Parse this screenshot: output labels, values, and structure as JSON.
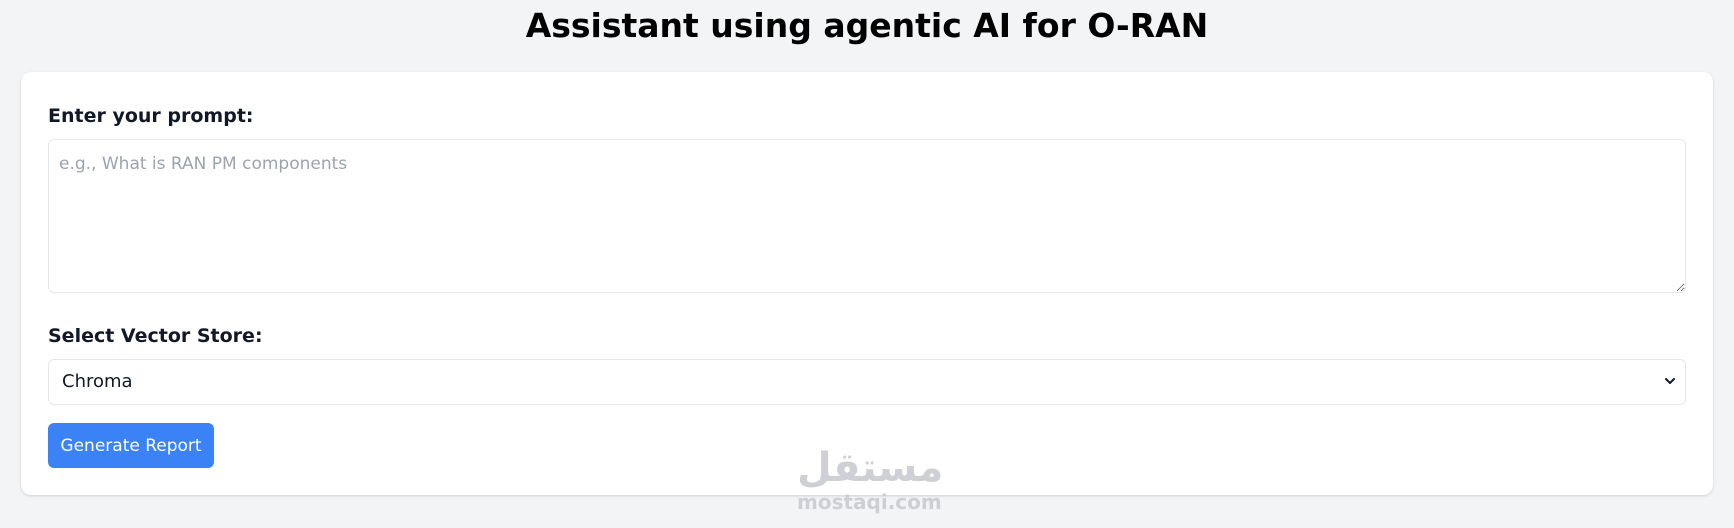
{
  "page": {
    "title": "Assistant using agentic AI for O-RAN"
  },
  "form": {
    "prompt_label": "Enter your prompt:",
    "prompt_placeholder": "e.g., What is RAN PM components",
    "prompt_value": "",
    "store_label": "Select Vector Store:",
    "store_selected": "Chroma",
    "generate_label": "Generate Report"
  },
  "watermark": {
    "arabic": "مستقل",
    "latin": "mostaqi.com"
  },
  "colors": {
    "background": "#f3f4f6",
    "card": "#ffffff",
    "accent": "#3b82f6"
  },
  "icons": {
    "select_arrow": "chevron-down-icon"
  }
}
